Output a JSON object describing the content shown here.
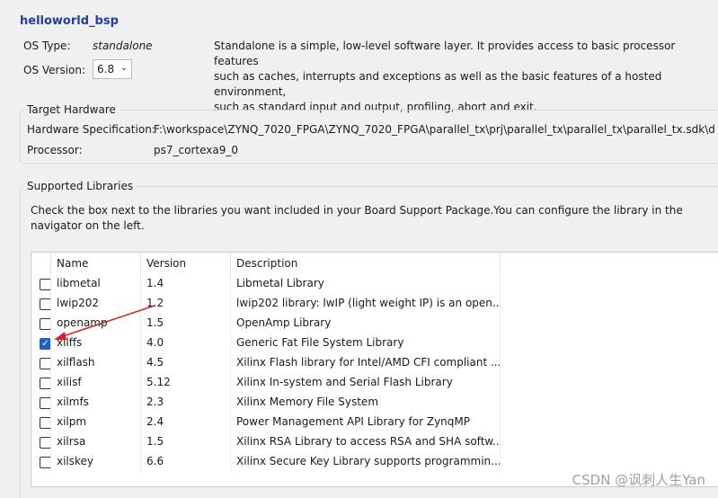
{
  "title": "helloworld_bsp",
  "os": {
    "type_label": "OS Type:",
    "type_value": "standalone",
    "version_label": "OS Version:",
    "version_value": "6.8",
    "description_lines": [
      "Standalone is a simple, low-level software layer. It provides access to basic processor features",
      "such as caches, interrupts and exceptions as well as the basic features of a hosted environment,",
      "such as standard input and output, profiling, abort and exit."
    ]
  },
  "hardware": {
    "group_title": "Target Hardware",
    "spec_label": "Hardware Specification:",
    "spec_value": "F:\\workspace\\ZYNQ_7020_FPGA\\ZYNQ_7020_FPGA\\parallel_tx\\prj\\parallel_tx\\parallel_tx\\parallel_tx.sdk\\desig",
    "processor_label": "Processor:",
    "processor_value": "ps7_cortexa9_0"
  },
  "libraries": {
    "group_title": "Supported Libraries",
    "instructions_lines": [
      "Check the box next to the libraries you want included in your Board Support Package.You can configure the library in the",
      "navigator on the left."
    ],
    "headers": [
      "Name",
      "Version",
      "Description"
    ],
    "rows": [
      {
        "name": "libmetal",
        "version": "1.4",
        "description": "Libmetal Library",
        "checked": false
      },
      {
        "name": "lwip202",
        "version": "1.2",
        "description": "lwip202 library: lwIP (light weight IP) is an open...",
        "checked": false
      },
      {
        "name": "openamp",
        "version": "1.5",
        "description": "OpenAmp Library",
        "checked": false
      },
      {
        "name": "xilffs",
        "version": "4.0",
        "description": "Generic Fat File System Library",
        "checked": true
      },
      {
        "name": "xilflash",
        "version": "4.5",
        "description": "Xilinx Flash library for Intel/AMD CFI compliant ...",
        "checked": false
      },
      {
        "name": "xilisf",
        "version": "5.12",
        "description": "Xilinx In-system and Serial Flash Library",
        "checked": false
      },
      {
        "name": "xilmfs",
        "version": "2.3",
        "description": "Xilinx Memory File System",
        "checked": false
      },
      {
        "name": "xilpm",
        "version": "2.4",
        "description": "Power Management API Library for ZynqMP",
        "checked": false
      },
      {
        "name": "xilrsa",
        "version": "1.5",
        "description": "Xilinx RSA Library to access RSA and SHA softw...",
        "checked": false
      },
      {
        "name": "xilskey",
        "version": "6.6",
        "description": "Xilinx Secure Key Library supports programmin...",
        "checked": false
      }
    ]
  },
  "watermark": "CSDN @讽刺人生Yan",
  "colors": {
    "title": "#1f3da8",
    "checkbox_checked": "#1c62c9",
    "annotation_arrow": "#e02020"
  }
}
